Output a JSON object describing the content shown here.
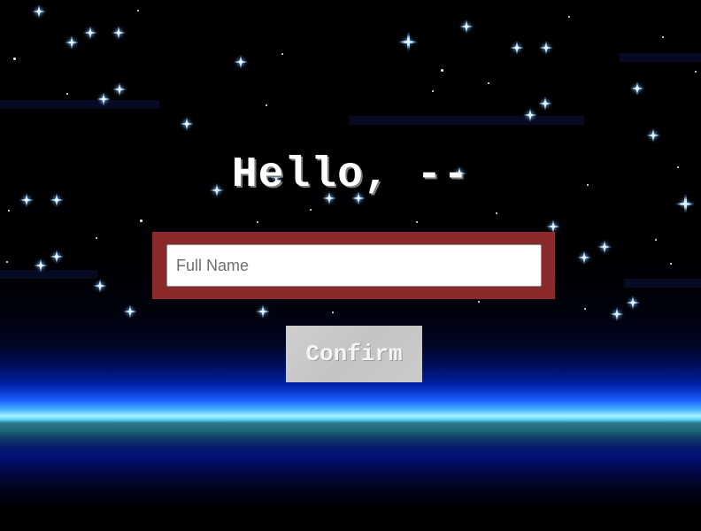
{
  "greeting": {
    "text": "Hello, --"
  },
  "name_field": {
    "value": "",
    "placeholder": "Full Name"
  },
  "confirm_button": {
    "label": "Confirm"
  },
  "colors": {
    "frame": "#8b2a2a",
    "horizon_glow": "#46b4ff",
    "button_bg": "#c8c8c8",
    "text": "#ffffff"
  }
}
